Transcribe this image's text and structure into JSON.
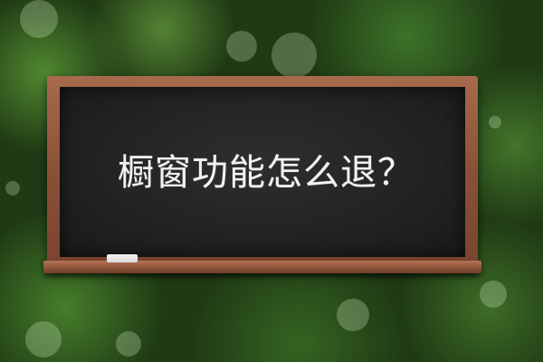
{
  "board": {
    "headline": "橱窗功能怎么退？"
  }
}
